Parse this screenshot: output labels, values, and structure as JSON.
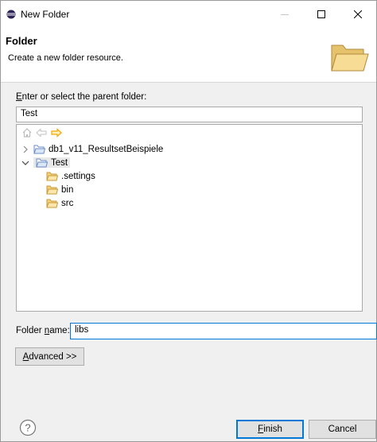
{
  "window": {
    "title": "New Folder"
  },
  "header": {
    "title": "Folder",
    "description": "Create a new folder resource."
  },
  "parent": {
    "label_key": "E",
    "label_rest": "nter or select the parent folder:",
    "value": "Test"
  },
  "tree": {
    "items": [
      {
        "label": "db1_v11_ResultsetBeispiele"
      },
      {
        "label": "Test"
      },
      {
        "label": ".settings"
      },
      {
        "label": "bin"
      },
      {
        "label": "src"
      }
    ]
  },
  "folder_name": {
    "label_pre": "Folder ",
    "label_key": "n",
    "label_post": "ame:",
    "value": "libs"
  },
  "advanced": {
    "key": "A",
    "rest": "dvanced >>"
  },
  "footer": {
    "finish_key": "F",
    "finish_rest": "inish",
    "cancel": "Cancel"
  },
  "colors": {
    "folder_fill": "#f4d27a",
    "folder_stroke": "#c89a3a",
    "nav_arrow": "#f0a800",
    "default_border": "#0078d7"
  }
}
